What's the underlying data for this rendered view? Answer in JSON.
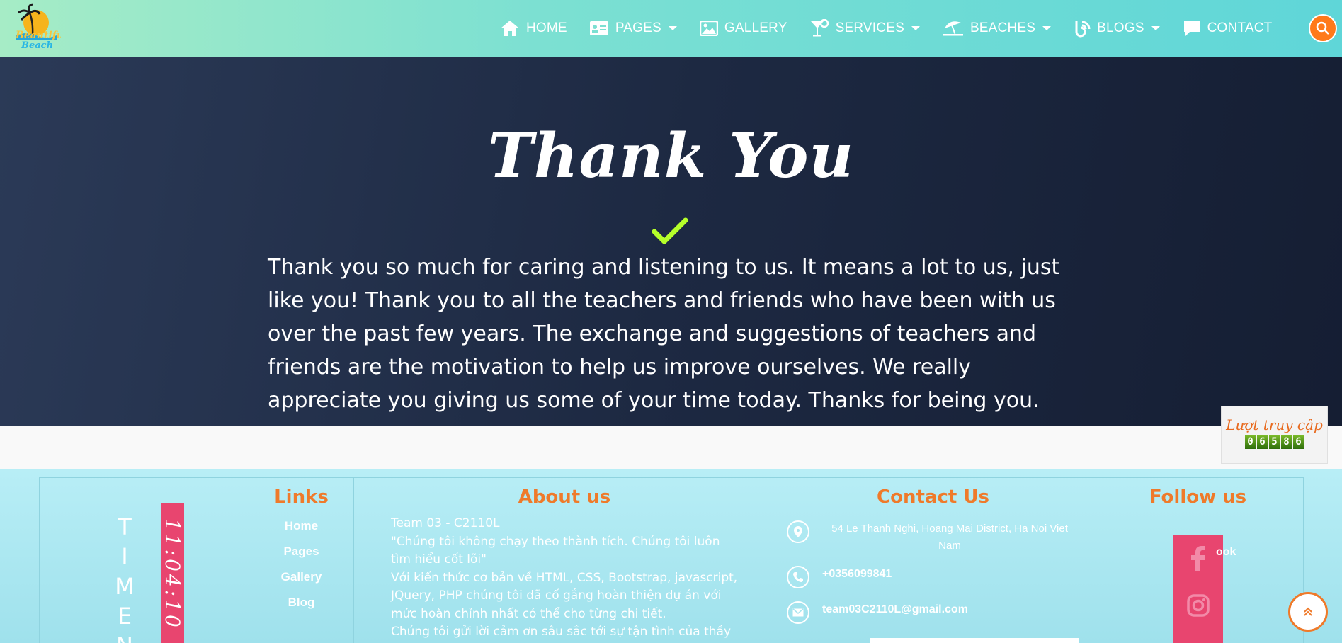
{
  "nav": {
    "items": [
      {
        "label": "HOME",
        "icon": "home-icon",
        "dropdown": false
      },
      {
        "label": "PAGES",
        "icon": "id-card-icon",
        "dropdown": true
      },
      {
        "label": "GALLERY",
        "icon": "image-icon",
        "dropdown": false
      },
      {
        "label": "SERVICES",
        "icon": "cocktail-icon",
        "dropdown": true
      },
      {
        "label": "BEACHES",
        "icon": "umbrella-beach-icon",
        "dropdown": true
      },
      {
        "label": "BLOGS",
        "icon": "blog-icon",
        "dropdown": true
      },
      {
        "label": "CONTACT",
        "icon": "chat-icon",
        "dropdown": false
      }
    ],
    "accent": "#ff7a1a"
  },
  "hero": {
    "title": "Thank You",
    "text": "Thank you so much for caring and listening to us. It means a lot to us, just like you! Thank you to all the teachers and friends who have been with us over the past few years. The exchange and suggestions of teachers and friends are the motivation to help us improve ourselves. We really appreciate you giving us some of your time today. Thanks for being you.",
    "check_color": "#b6ff2a"
  },
  "counter": {
    "label": "Lượt truy cập",
    "digits": [
      "0",
      "6",
      "5",
      "8",
      "6"
    ]
  },
  "footer": {
    "time": {
      "letters": [
        "T",
        "I",
        "M",
        "E",
        "N"
      ],
      "clock": "11:04:10"
    },
    "links": {
      "heading": "Links",
      "items": [
        "Home",
        "Pages",
        "Gallery",
        "Blog"
      ]
    },
    "about": {
      "heading": "About us",
      "lines": [
        "Team 03 - C2110L",
        "\"Chúng tôi không chạy theo thành tích. Chúng tôi luôn tìm hiểu cốt lõi\"",
        "Với kiến thức cơ bản về HTML, CSS, Bootstrap, javascript, JQuery, PHP chúng tôi đã cố gắng hoàn thiện dự án với mức hoàn chỉnh nhất có thể cho từng chi tiết.",
        "Chúng tôi gửi lời cảm ơn sâu sắc tới sự tận tình của thầy giáo"
      ]
    },
    "contact": {
      "heading": "Contact Us",
      "address": "54 Le Thanh Nghi, Hoang Mai District, Ha Noi Viet Nam",
      "phone": "+0356099841",
      "email": "team03C2110L@gmail.com"
    },
    "follow": {
      "heading": "Follow us",
      "facebook_label": "ook"
    }
  },
  "colors": {
    "heading_orange": "#ef7a2a",
    "social_pink": "#e8456f"
  }
}
